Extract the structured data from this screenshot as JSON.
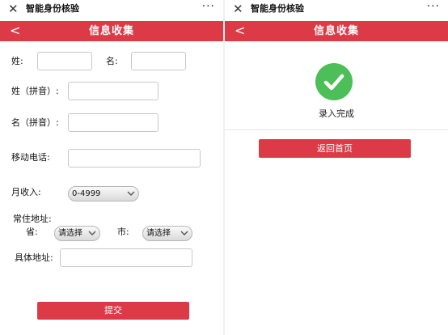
{
  "app": {
    "title": "智能身份核验",
    "close_symbol": "✕",
    "more_symbol": "···"
  },
  "header": {
    "back_symbol": "<",
    "title": "信息收集"
  },
  "form": {
    "surname_label": "姓:",
    "given_label": "名:",
    "surname_pinyin_label": "姓（拼音）:",
    "given_pinyin_label": "名（拼音）:",
    "mobile_label": "移动电话:",
    "income_label": "月收入:",
    "income_value": "0-4999",
    "address_label": "常住地址:",
    "province_label": "省:",
    "province_value": "请选择",
    "city_label": "市:",
    "city_value": "请选择",
    "detail_address_label": "具体地址:",
    "submit_label": "提交"
  },
  "result": {
    "message": "录入完成",
    "home_button_label": "返回首页",
    "success_color": "#4cbf58"
  },
  "colors": {
    "accent": "#dd3a48"
  }
}
